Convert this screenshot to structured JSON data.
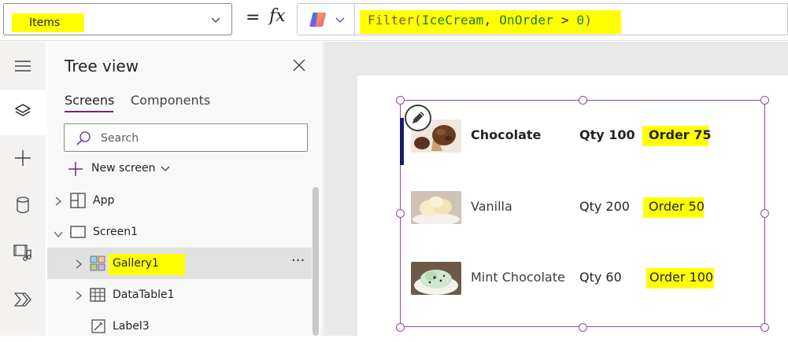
{
  "formula_bar": {
    "property": "Items",
    "equals": "=",
    "fx": "fx",
    "formula": "Filter(IceCream, OnOrder > 0)",
    "formula_parts": {
      "func": "Filter",
      "open": "(",
      "table": "IceCream",
      "comma": ", ",
      "field": "OnOrder",
      "op": " > ",
      "num": "0",
      "close": ")"
    }
  },
  "rail": {
    "items": [
      {
        "icon": "hamburger-menu-icon"
      },
      {
        "icon": "layers-icon",
        "active": true
      },
      {
        "icon": "plus-icon"
      },
      {
        "icon": "database-icon"
      },
      {
        "icon": "media-icon"
      },
      {
        "icon": "power-automate-icon"
      }
    ]
  },
  "tree_view": {
    "title": "Tree view",
    "tabs": [
      {
        "label": "Screens",
        "active": true
      },
      {
        "label": "Components",
        "active": false
      }
    ],
    "search_placeholder": "Search",
    "new_screen_label": "New screen",
    "rows": [
      {
        "label": "App",
        "icon": "app-icon",
        "expander": "collapsed"
      },
      {
        "label": "Screen1",
        "icon": "screen-icon",
        "expander": "expanded"
      },
      {
        "label": "Gallery1",
        "icon": "gallery-icon",
        "expander": "collapsed",
        "selected": true,
        "more": "···"
      },
      {
        "label": "DataTable1",
        "icon": "datatable-icon",
        "expander": "collapsed"
      },
      {
        "label": "Label3",
        "icon": "label-icon"
      }
    ]
  },
  "gallery": {
    "items": [
      {
        "name": "Chocolate",
        "qty": "Qty 100",
        "order": "Order 75",
        "image": "chocolate-ice-cream-image",
        "selected": true
      },
      {
        "name": "Vanilla",
        "qty": "Qty 200",
        "order": "Order 50",
        "image": "vanilla-ice-cream-image"
      },
      {
        "name": "Mint Chocolate",
        "qty": "Qty 60",
        "order": "Order 100",
        "image": "mint-chocolate-ice-cream-image"
      }
    ]
  },
  "colors": {
    "highlight": "#ffff00",
    "selection_purple": "#8b4e9b",
    "accent_purple": "#742774",
    "formula_func": "#795e26",
    "formula_table": "#1f7a1f",
    "formula_field": "#1f7a1f"
  }
}
